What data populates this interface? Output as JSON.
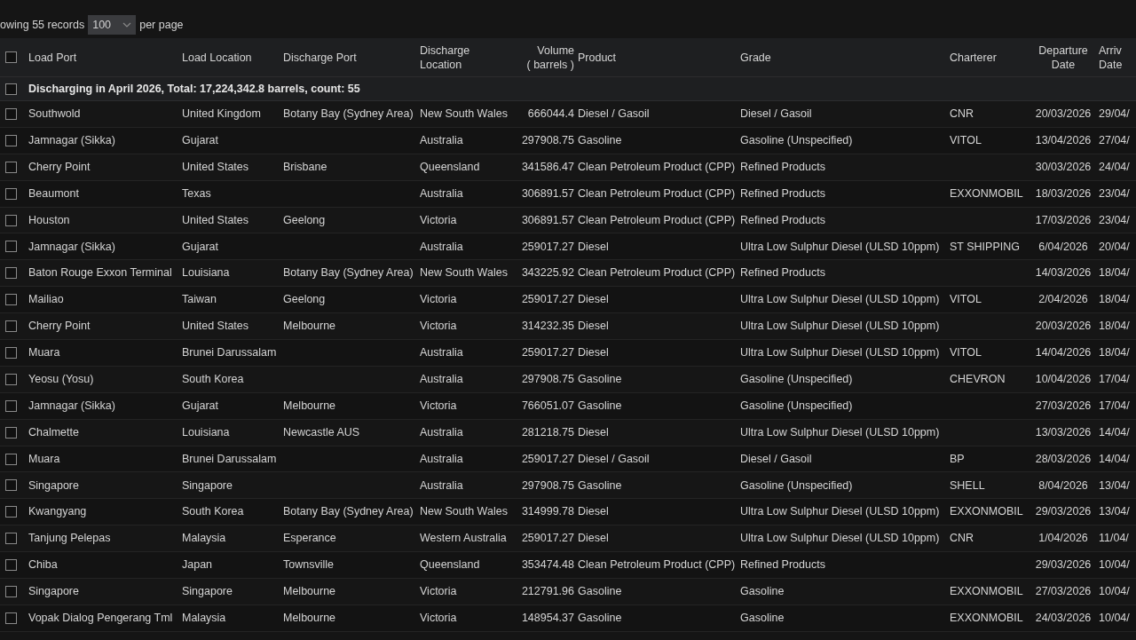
{
  "pager": {
    "prefix": "owing 55 records",
    "page_size": "100",
    "suffix": "per page"
  },
  "table": {
    "header_checked": false,
    "columns": [
      {
        "lines": [
          "Load Port"
        ]
      },
      {
        "lines": [
          "Load Location"
        ]
      },
      {
        "lines": [
          "Discharge Port"
        ]
      },
      {
        "lines": [
          "Discharge",
          "Location"
        ]
      },
      {
        "lines": [
          "Volume",
          "( barrels )"
        ]
      },
      {
        "lines": [
          "Product"
        ]
      },
      {
        "lines": [
          "Grade"
        ]
      },
      {
        "lines": [
          "Charterer"
        ]
      },
      {
        "lines": [
          "Departure",
          "Date"
        ]
      },
      {
        "lines": [
          "Arriv",
          "Date"
        ]
      }
    ],
    "group": {
      "label": "Discharging in April 2026, Total: 17,224,342.8 barrels, count: 55",
      "checked": false
    },
    "rows": [
      {
        "checked": false,
        "cells": [
          "Southwold",
          "United Kingdom",
          "Botany Bay (Sydney Area)",
          "New South Wales",
          "666044.4",
          "Diesel / Gasoil",
          "Diesel / Gasoil",
          "CNR",
          "20/03/2026",
          "29/04/"
        ]
      },
      {
        "checked": false,
        "cells": [
          "Jamnagar (Sikka)",
          "Gujarat",
          "",
          "Australia",
          "297908.75",
          "Gasoline",
          "Gasoline (Unspecified)",
          "VITOL",
          "13/04/2026",
          "27/04/"
        ]
      },
      {
        "checked": false,
        "cells": [
          "Cherry Point",
          "United States",
          "Brisbane",
          "Queensland",
          "341586.47",
          "Clean Petroleum Product (CPP)",
          "Refined Products",
          "",
          "30/03/2026",
          "24/04/"
        ]
      },
      {
        "checked": false,
        "cells": [
          "Beaumont",
          "Texas",
          "",
          "Australia",
          "306891.57",
          "Clean Petroleum Product (CPP)",
          "Refined Products",
          "EXXONMOBIL",
          "18/03/2026",
          "23/04/"
        ]
      },
      {
        "checked": false,
        "cells": [
          "Houston",
          "United States",
          "Geelong",
          "Victoria",
          "306891.57",
          "Clean Petroleum Product (CPP)",
          "Refined Products",
          "",
          "17/03/2026",
          "23/04/"
        ]
      },
      {
        "checked": false,
        "cells": [
          "Jamnagar (Sikka)",
          "Gujarat",
          "",
          "Australia",
          "259017.27",
          "Diesel",
          "Ultra Low Sulphur Diesel (ULSD 10ppm)",
          "ST SHIPPING",
          "6/04/2026",
          "20/04/"
        ]
      },
      {
        "checked": false,
        "cells": [
          "Baton Rouge Exxon Terminal",
          "Louisiana",
          "Botany Bay (Sydney Area)",
          "New South Wales",
          "343225.92",
          "Clean Petroleum Product (CPP)",
          "Refined Products",
          "",
          "14/03/2026",
          "18/04/"
        ]
      },
      {
        "checked": false,
        "cells": [
          "Mailiao",
          "Taiwan",
          "Geelong",
          "Victoria",
          "259017.27",
          "Diesel",
          "Ultra Low Sulphur Diesel (ULSD 10ppm)",
          "VITOL",
          "2/04/2026",
          "18/04/"
        ]
      },
      {
        "checked": false,
        "cells": [
          "Cherry Point",
          "United States",
          "Melbourne",
          "Victoria",
          "314232.35",
          "Diesel",
          "Ultra Low Sulphur Diesel (ULSD 10ppm)",
          "",
          "20/03/2026",
          "18/04/"
        ]
      },
      {
        "checked": false,
        "cells": [
          "Muara",
          "Brunei Darussalam",
          "",
          "Australia",
          "259017.27",
          "Diesel",
          "Ultra Low Sulphur Diesel (ULSD 10ppm)",
          "VITOL",
          "14/04/2026",
          "18/04/"
        ]
      },
      {
        "checked": false,
        "cells": [
          "Yeosu (Yosu)",
          "South Korea",
          "",
          "Australia",
          "297908.75",
          "Gasoline",
          "Gasoline (Unspecified)",
          "CHEVRON",
          "10/04/2026",
          "17/04/"
        ]
      },
      {
        "checked": false,
        "cells": [
          "Jamnagar (Sikka)",
          "Gujarat",
          "Melbourne",
          "Victoria",
          "766051.07",
          "Gasoline",
          "Gasoline (Unspecified)",
          "",
          "27/03/2026",
          "17/04/"
        ]
      },
      {
        "checked": false,
        "cells": [
          "Chalmette",
          "Louisiana",
          "Newcastle AUS",
          "Australia",
          "281218.75",
          "Diesel",
          "Ultra Low Sulphur Diesel (ULSD 10ppm)",
          "",
          "13/03/2026",
          "14/04/"
        ]
      },
      {
        "checked": false,
        "cells": [
          "Muara",
          "Brunei Darussalam",
          "",
          "Australia",
          "259017.27",
          "Diesel / Gasoil",
          "Diesel / Gasoil",
          "BP",
          "28/03/2026",
          "14/04/"
        ]
      },
      {
        "checked": false,
        "cells": [
          "Singapore",
          "Singapore",
          "",
          "Australia",
          "297908.75",
          "Gasoline",
          "Gasoline (Unspecified)",
          "SHELL",
          "8/04/2026",
          "13/04/"
        ]
      },
      {
        "checked": false,
        "cells": [
          "Kwangyang",
          "South Korea",
          "Botany Bay (Sydney Area)",
          "New South Wales",
          "314999.78",
          "Diesel",
          "Ultra Low Sulphur Diesel (ULSD 10ppm)",
          "EXXONMOBIL",
          "29/03/2026",
          "13/04/"
        ]
      },
      {
        "checked": false,
        "cells": [
          "Tanjung Pelepas",
          "Malaysia",
          "Esperance",
          "Western Australia",
          "259017.27",
          "Diesel",
          "Ultra Low Sulphur Diesel (ULSD 10ppm)",
          "CNR",
          "1/04/2026",
          "11/04/"
        ]
      },
      {
        "checked": false,
        "cells": [
          "Chiba",
          "Japan",
          "Townsville",
          "Queensland",
          "353474.48",
          "Clean Petroleum Product (CPP)",
          "Refined Products",
          "",
          "29/03/2026",
          "10/04/"
        ]
      },
      {
        "checked": false,
        "cells": [
          "Singapore",
          "Singapore",
          "Melbourne",
          "Victoria",
          "212791.96",
          "Gasoline",
          "Gasoline",
          "EXXONMOBIL",
          "27/03/2026",
          "10/04/"
        ]
      },
      {
        "checked": false,
        "cells": [
          "Vopak Dialog Pengerang Tml",
          "Malaysia",
          "Melbourne",
          "Victoria",
          "148954.37",
          "Gasoline",
          "Gasoline",
          "EXXONMOBIL",
          "24/03/2026",
          "10/04/"
        ]
      }
    ]
  }
}
